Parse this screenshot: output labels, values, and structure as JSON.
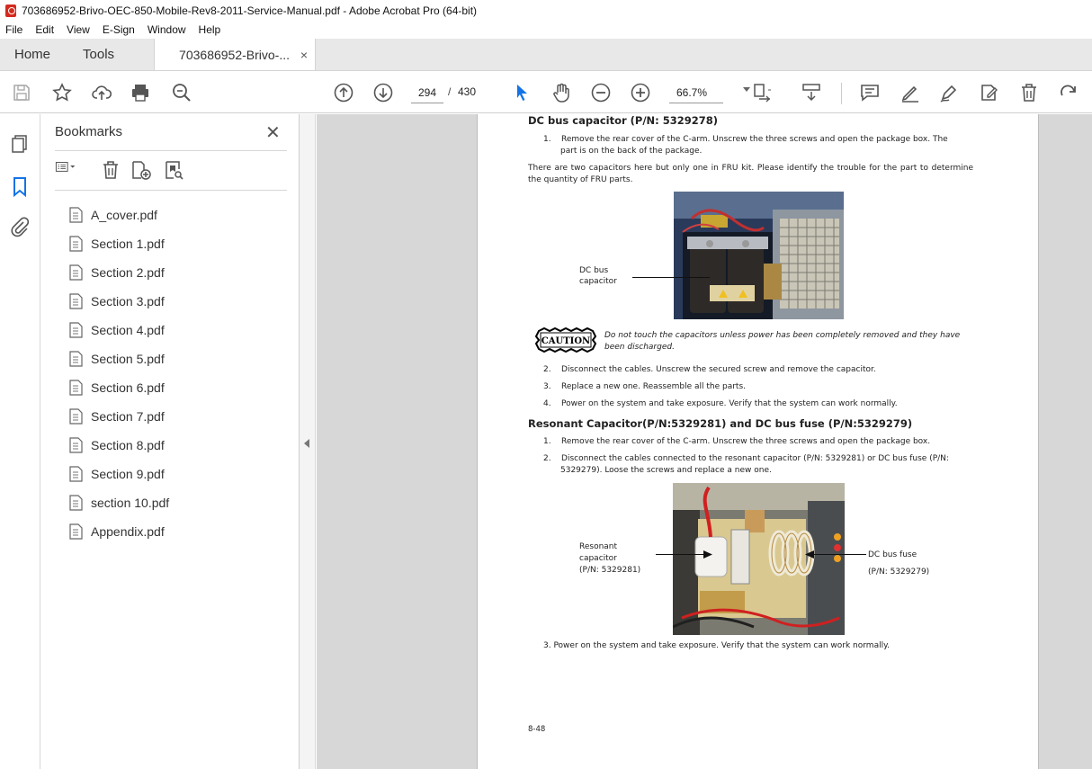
{
  "window": {
    "title": "703686952-Brivo-OEC-850-Mobile-Rev8-2011-Service-Manual.pdf - Adobe Acrobat Pro (64-bit)"
  },
  "menu": [
    "File",
    "Edit",
    "View",
    "E-Sign",
    "Window",
    "Help"
  ],
  "tabs": {
    "home": "Home",
    "tools": "Tools",
    "document": "703686952-Brivo-...",
    "close": "×"
  },
  "toolbar": {
    "current_page": "294",
    "separator": "/",
    "total_pages": "430",
    "zoom": "66.7%"
  },
  "bookmarks": {
    "title": "Bookmarks",
    "close": "✕",
    "items": [
      "A_cover.pdf",
      "Section 1.pdf",
      "Section 2.pdf",
      "Section 3.pdf",
      "Section 4.pdf",
      "Section 5.pdf",
      "Section 6.pdf",
      "Section 7.pdf",
      "Section 8.pdf",
      "Section 9.pdf",
      "section 10.pdf",
      "Appendix.pdf"
    ]
  },
  "document": {
    "heading1": "DC bus capacitor (P/N: 5329278)",
    "step1a": "1.    Remove the rear cover of the C-arm. Unscrew the three screws and open the package box. The",
    "step1b": "part is on the back of the package.",
    "note": "There are two capacitors here but only one in FRU kit. Please identify the trouble for the part to determine the quantity of FRU parts.",
    "fig1_label": "DC bus capacitor",
    "caution_badge": "CAUTION",
    "caution_text": "Do not touch the capacitors unless power has been completely removed and they have been discharged.",
    "step2": "2.    Disconnect the cables.  Unscrew the secured screw and remove the capacitor.",
    "step3": "3.    Replace a new one. Reassemble all the parts.",
    "step4": "4.    Power on the system and take exposure. Verify that the system can work normally.",
    "heading2": "Resonant Capacitor(P/N:5329281) and DC bus fuse (P/N:5329279)",
    "r_step1": "1.    Remove the rear cover of the C-arm. Unscrew the three screws and open the package box.",
    "r_step2a": "2.    Disconnect the cables connected to the resonant capacitor (P/N: 5329281) or DC bus fuse (P/N:",
    "r_step2b": "5329279). Loose the screws and replace a new one.",
    "fig2_label_left_1": "Resonant",
    "fig2_label_left_2": "capacitor",
    "fig2_label_left_3": "(P/N: 5329281)",
    "fig2_label_right_1": "DC bus fuse",
    "fig2_label_right_2": "(P/N: 5329279)",
    "r_step3": "3. Power on the system and take exposure. Verify that the system can work normally.",
    "page_number": "8-48"
  }
}
